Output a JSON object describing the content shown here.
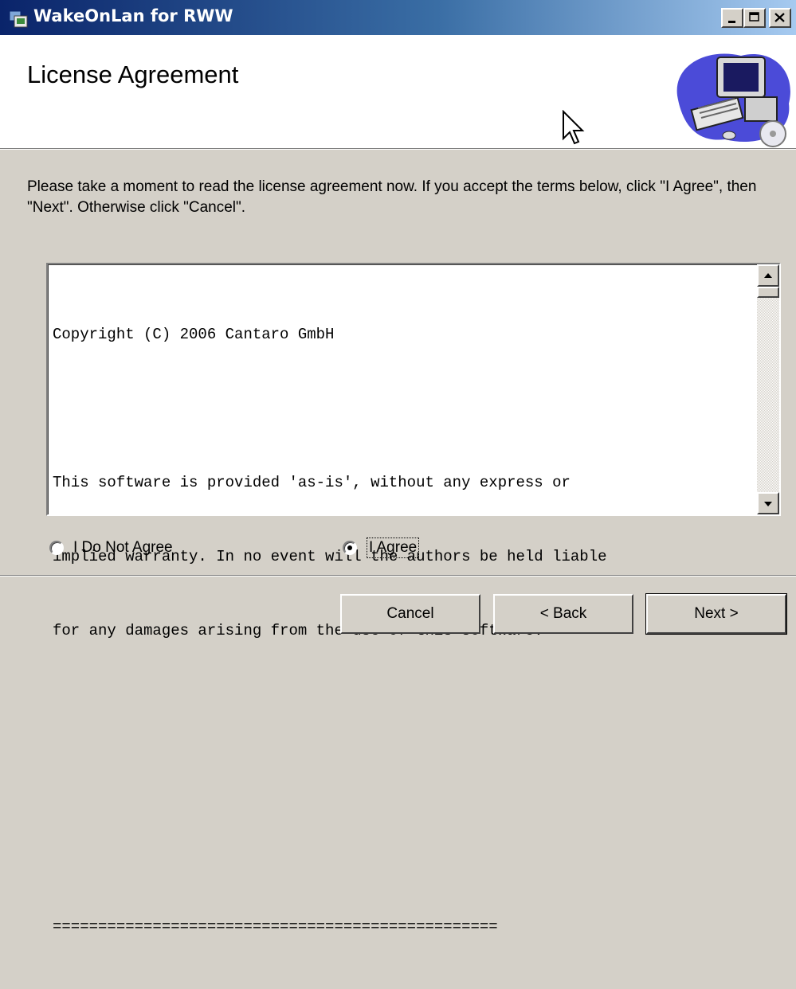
{
  "window": {
    "title": "WakeOnLan for RWW",
    "controls": [
      "minimize-icon",
      "maximize-icon",
      "close-icon"
    ]
  },
  "header": {
    "title": "License Agreement",
    "logo_icon": "computer-setup-icon"
  },
  "intro_text": "Please take a moment to read the license agreement now. If you accept the terms below, click \"I Agree\", then \"Next\". Otherwise click \"Cancel\".",
  "license": {
    "lines": [
      "Copyright (C) 2006 Cantaro GmbH",
      "",
      "This software is provided 'as-is', without any express or",
      "implied warranty. In no event will the authors be held liable",
      "for any damages arising from the use of this software.",
      "",
      "",
      "",
      "================================================="
    ]
  },
  "options": {
    "disagree_label": "I Do Not Agree",
    "agree_label": "I Agree",
    "selected": "agree"
  },
  "buttons": {
    "cancel": "Cancel",
    "back": "< Back",
    "next": "Next >"
  }
}
